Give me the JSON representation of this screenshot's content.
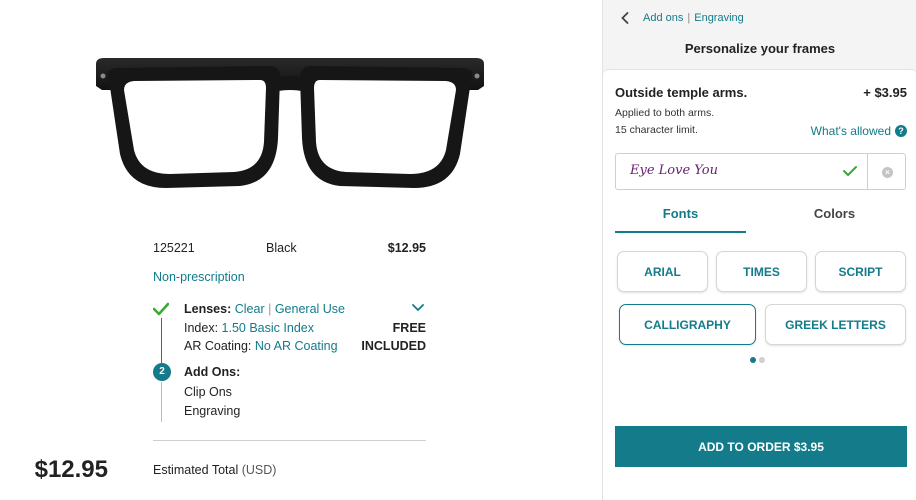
{
  "summary": {
    "sku": "125221",
    "color": "Black",
    "price": "$12.95",
    "rx_type": "Non-prescription",
    "lenses_label": "Lenses:",
    "lenses_value1": "Clear",
    "lenses_sep": "|",
    "lenses_value2": "General Use",
    "index_label": "Index:",
    "index_value": "1.50 Basic Index",
    "index_price": "FREE",
    "ar_label": "AR Coating:",
    "ar_value": "No AR Coating",
    "ar_price": "INCLUDED",
    "step2_number": "2",
    "addons_label": "Add Ons:",
    "addon1": "Clip Ons",
    "addon2": "Engraving",
    "total_label": "Estimated Total",
    "total_currency": "(USD)",
    "total_amount": "$12.95"
  },
  "panel": {
    "crumb1": "Add ons",
    "crumb_sep": "|",
    "crumb2": "Engraving",
    "title": "Personalize your frames",
    "option_title": "Outside temple arms.",
    "option_price": "+ $3.95",
    "option_sub1": "Applied to both arms.",
    "option_sub2": "15 character limit.",
    "whats_allowed": "What's allowed",
    "help_glyph": "?",
    "engraving_value": "Eye Love You",
    "tabs": {
      "fonts": "Fonts",
      "colors": "Colors"
    },
    "fonts": [
      "ARIAL",
      "TIMES",
      "SCRIPT",
      "CALLIGRAPHY",
      "GREEK LETTERS"
    ],
    "selected_font": "CALLIGRAPHY",
    "add_button": "ADD TO ORDER $3.95"
  },
  "colors": {
    "accent": "#137b8a",
    "engraving_text": "#6a1b74",
    "success": "#3aaa35"
  },
  "icons": [
    "eyeglasses-image",
    "check-icon",
    "chevron-down-icon",
    "back-arrow-icon",
    "help-icon",
    "clear-icon"
  ]
}
